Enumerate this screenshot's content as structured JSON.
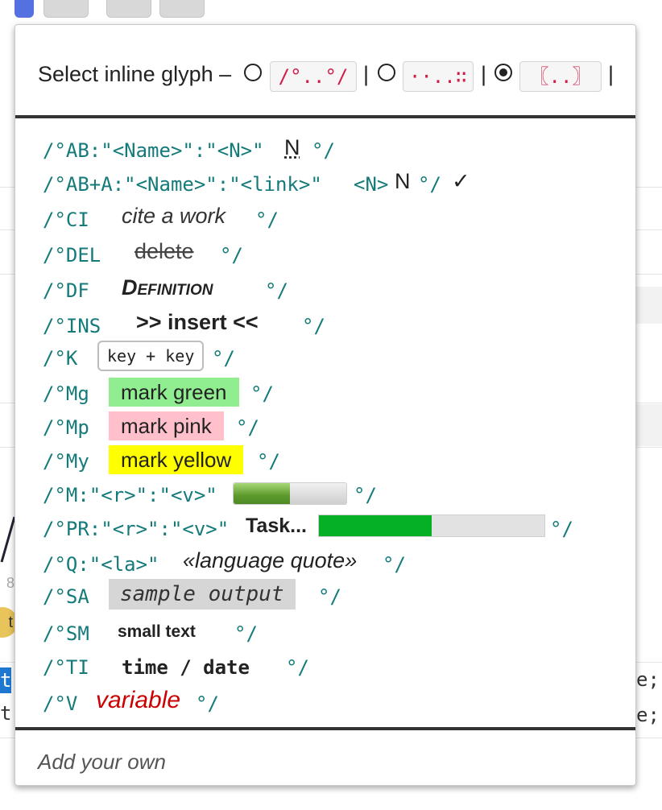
{
  "popup": {
    "header": {
      "label": "Select inline glyph –",
      "options": [
        {
          "glyph": "/°..°/",
          "selected": false
        },
        {
          "glyph": "··..∷",
          "selected": false
        },
        {
          "glyph": "〖..〗",
          "selected": true
        }
      ],
      "separator": "|"
    },
    "entries": {
      "ab": {
        "code": "/°AB:\"<Name>\":\"<N>\"",
        "sample": "N",
        "close": "°/"
      },
      "aba": {
        "code": "/°AB+A:\"<Name>\":\"<link>\"",
        "n_tag": "<N>",
        "sample": "N",
        "close": "°/",
        "check": "✓"
      },
      "ci": {
        "code": "/°CI",
        "sample": "cite a work",
        "close": "°/"
      },
      "del": {
        "code": "/°DEL",
        "sample": "delete",
        "close": "°/"
      },
      "df": {
        "code": "/°DF",
        "sample": "Definition",
        "close": "°/"
      },
      "ins": {
        "code": "/°INS",
        "sample": ">> insert <<",
        "close": "°/"
      },
      "k": {
        "code": "/°K",
        "sample": "key + key",
        "close": "°/"
      },
      "mg": {
        "code": "/°Mg",
        "sample": "mark green",
        "close": "°/",
        "color": "#90ee90"
      },
      "mp": {
        "code": "/°Mp",
        "sample": "mark pink",
        "close": "°/",
        "color": "#ffc0cb"
      },
      "my": {
        "code": "/°My",
        "sample": "mark yellow",
        "close": "°/",
        "color": "#ffff00"
      },
      "m": {
        "code": "/°M:\"<r>\":\"<v>\"",
        "meter_fraction": 0.5,
        "close": "°/"
      },
      "pr": {
        "code": "/°PR:\"<r>\":\"<v>\"",
        "label": "Task...",
        "progress_fraction": 0.5,
        "close": "°/"
      },
      "q": {
        "code": "/°Q:\"<la>\"",
        "sample": "«language quote»",
        "close": "°/"
      },
      "sa": {
        "code": "/°SA",
        "sample": "sample output",
        "close": "°/"
      },
      "sm": {
        "code": "/°SM",
        "sample": "small text",
        "close": "°/"
      },
      "ti": {
        "code": "/°TI",
        "sample": "time / date",
        "close": "°/"
      },
      "v": {
        "code": "/°V",
        "sample": "variable",
        "close": "°/",
        "color": "#cc0000"
      }
    },
    "footer": {
      "label": "Add your own"
    }
  },
  "background": {
    "code_right_1": "e;",
    "code_right_2": "e;",
    "code_left_1": "t",
    "code_left_2": "t",
    "badge": "t",
    "number": "8"
  }
}
